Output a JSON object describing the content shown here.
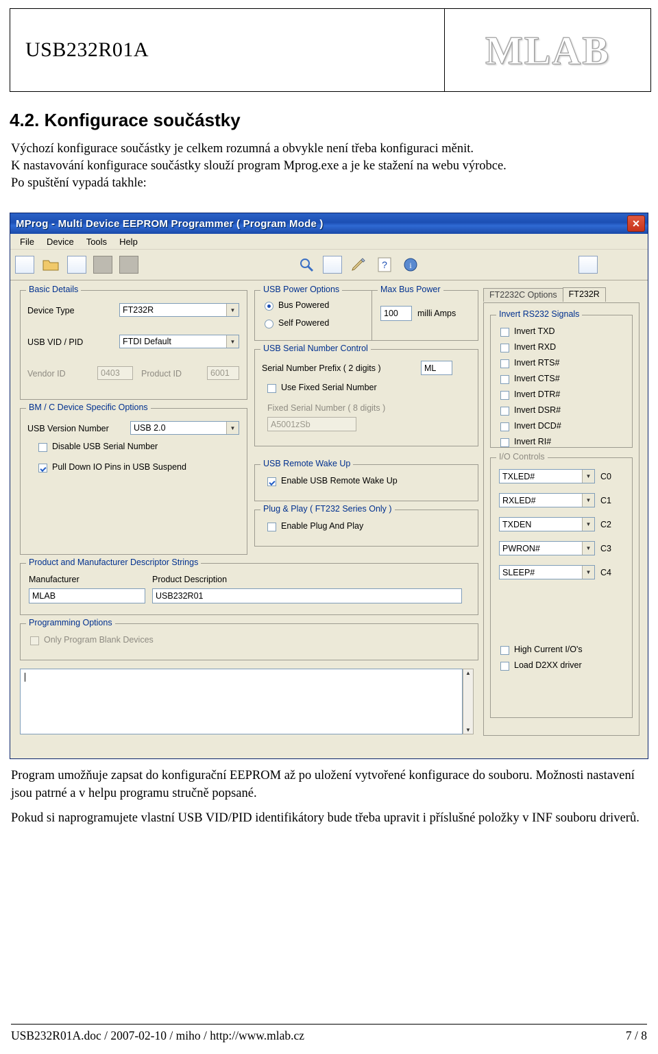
{
  "header": {
    "doc_code": "USB232R01A",
    "logo_text": "MLAB"
  },
  "section": {
    "heading": "4.2. Konfigurace součástky",
    "intro_lines": [
      "Výchozí konfigurace součástky je celkem rozumná a obvykle není třeba konfiguraci měnit.",
      "K nastavování konfigurace součástky slouží program Mprog.exe a je ke stažení na webu výrobce.",
      "Po spuštění vypadá takhle:"
    ]
  },
  "app": {
    "title": "MProg - Multi Device EEPROM Programmer ( Program Mode )",
    "close_label": "✕",
    "menu": [
      "File",
      "Device",
      "Tools",
      "Help"
    ],
    "toolbar_icons": [
      "new-doc-icon",
      "open-folder-icon",
      "edit-doc-icon",
      "stop-icon",
      "stop2-icon",
      "scan-icon",
      "erase-icon",
      "program-icon",
      "help-question-icon",
      "about-icon",
      "device-icon"
    ],
    "basic_details": {
      "legend": "Basic Details",
      "device_type_label": "Device Type",
      "device_type_value": "FT232R",
      "usb_vid_pid_label": "USB VID / PID",
      "usb_vid_pid_value": "FTDI Default",
      "vendor_id_label": "Vendor ID",
      "vendor_id_value": "0403",
      "product_id_label": "Product ID",
      "product_id_value": "6001"
    },
    "bm_options": {
      "legend": "BM / C Device Specific Options",
      "usb_version_label": "USB Version Number",
      "usb_version_value": "USB 2.0",
      "disable_serial_label": "Disable USB Serial Number",
      "disable_serial_checked": false,
      "pulldown_label": "Pull Down IO Pins in USB Suspend",
      "pulldown_checked": true
    },
    "usb_power": {
      "legend": "USB Power Options",
      "bus_powered_label": "Bus Powered",
      "self_powered_label": "Self Powered",
      "selected": "Bus Powered",
      "max_bus_power_label": "Max Bus Power",
      "max_bus_power_value": "100",
      "milli_amps_label": "milli Amps"
    },
    "serial_control": {
      "legend": "USB Serial Number Control",
      "prefix_label": "Serial Number Prefix ( 2 digits )",
      "prefix_value": "ML",
      "use_fixed_label": "Use Fixed Serial Number",
      "use_fixed_checked": false,
      "fixed_label": "Fixed Serial Number ( 8 digits )",
      "fixed_value": "A5001zSb"
    },
    "remote_wakeup": {
      "legend": "USB Remote Wake Up",
      "enable_label": "Enable USB Remote Wake Up",
      "enable_checked": true
    },
    "plug_play": {
      "legend": "Plug & Play ( FT232 Series Only )",
      "enable_label": "Enable Plug And Play",
      "enable_checked": false
    },
    "descriptor_strings": {
      "legend": "Product and Manufacturer Descriptor Strings",
      "manufacturer_label": "Manufacturer",
      "manufacturer_value": "MLAB",
      "product_label": "Product Description",
      "product_value": "USB232R01"
    },
    "programming_options": {
      "legend": "Programming Options",
      "only_blank_label": "Only Program Blank Devices",
      "only_blank_checked": false
    },
    "log": {
      "value": ""
    },
    "right_tabs": [
      {
        "label": "FT2232C Options",
        "active": false
      },
      {
        "label": "FT232R",
        "active": true
      }
    ],
    "invert_signals": {
      "legend": "Invert RS232 Signals",
      "items": [
        {
          "label": "Invert TXD",
          "checked": false
        },
        {
          "label": "Invert RXD",
          "checked": false
        },
        {
          "label": "Invert RTS#",
          "checked": false
        },
        {
          "label": "Invert CTS#",
          "checked": false
        },
        {
          "label": "Invert DTR#",
          "checked": false
        },
        {
          "label": "Invert DSR#",
          "checked": false
        },
        {
          "label": "Invert DCD#",
          "checked": false
        },
        {
          "label": "Invert RI#",
          "checked": false
        }
      ]
    },
    "io_controls": {
      "legend": "I/O Controls",
      "rows": [
        {
          "value": "TXLED#",
          "pin": "C0"
        },
        {
          "value": "RXLED#",
          "pin": "C1"
        },
        {
          "value": "TXDEN",
          "pin": "C2"
        },
        {
          "value": "PWRON#",
          "pin": "C3"
        },
        {
          "value": "SLEEP#",
          "pin": "C4"
        }
      ]
    },
    "misc": [
      {
        "label": "High Current I/O's",
        "checked": false
      },
      {
        "label": "Load D2XX driver",
        "checked": false
      }
    ]
  },
  "after_text": [
    "Program umožňuje zapsat do konfigurační EEPROM až po uložení vytvořené konfigurace do souboru. Možnosti nastavení jsou patrné a v helpu programu stručně popsané.",
    "Pokud si naprogramujete vlastní USB VID/PID identifikátory bude třeba upravit i příslušné položky v INF souboru driverů."
  ],
  "footer": {
    "left": "USB232R01A.doc / 2007-02-10 / miho / http://www.mlab.cz",
    "right": "7 / 8"
  }
}
